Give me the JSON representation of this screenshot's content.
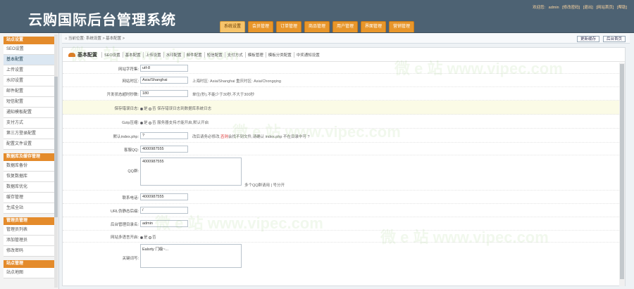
{
  "header": {
    "title": "云购国际后台管理系统",
    "tabs": [
      "系统设置",
      "会员管理",
      "订单管理",
      "商品管理",
      "用户管理",
      "界面管理",
      "营销管理"
    ],
    "active_tab": 0,
    "user_links": [
      "欢迎您:",
      "admin",
      "[修改密码]",
      "[退出]",
      "[网站首页]",
      "[帮助]"
    ]
  },
  "sidebar": {
    "groups": [
      {
        "title": "站点设置",
        "items": [
          "SEO设置",
          "基本配置",
          "上传设置",
          "水印设置",
          "邮件配置",
          "短信配置",
          "通知模板配置",
          "支付方式",
          "第三方登录配置",
          "配置文件设置"
        ]
      },
      {
        "title": "数据库及缓存管理",
        "items": [
          "数据库备份",
          "恢复数据库",
          "数据库优化",
          "缓存管理",
          "生成全站"
        ]
      },
      {
        "title": "管理员管理",
        "items": [
          "管理员列表",
          "添加管理员",
          "修改密码"
        ]
      },
      {
        "title": "站点管理",
        "items": [
          "站点地图"
        ]
      }
    ],
    "active_item": "基本配置"
  },
  "breadcrumb": {
    "text": "当前位置: 系统设置 > 基本配置 >",
    "buttons": [
      "更新缓存",
      "后台首页"
    ]
  },
  "panel": {
    "title": "基本配置",
    "subtabs": [
      "SEO设置",
      "基本配置",
      "上传设置",
      "水印配置",
      "邮件配置",
      "短信配置",
      "支付方式",
      "模板管理",
      "模板分类配置",
      "中奖通知设置"
    ]
  },
  "form": {
    "charset": {
      "label": "网站字符集:",
      "value": "utf-8"
    },
    "timezone": {
      "label": "网站时区:",
      "value": "Asia/Shanghai",
      "hint": "上海时区: Asia/Shanghai 重庆时区: Asia/Chongqing"
    },
    "timeout": {
      "label": "开发状态超时秒数:",
      "value": "180",
      "hint": "单位(秒),不能少于30秒,不大于300秒"
    },
    "error_log": {
      "label": "保存错误日志:",
      "opt_yes": "是",
      "opt_no": "否",
      "hint": "保存错误日志到数据库系统日志"
    },
    "gzip": {
      "label": "Gzip压缩:",
      "opt_yes": "是",
      "opt_no": "否",
      "hint": "服务器支持才能开启,默认开启"
    },
    "index_name": {
      "label": "默认index.php:",
      "value": "?",
      "hint_pre": "改后请务必修改,",
      "hint_red": "否则",
      "hint_post": "会找不到文件,请确认 index.php 不在目录中可 ?"
    },
    "qq": {
      "label": "客服QQ:",
      "value": "4000987555"
    },
    "qq_group": {
      "label": "QQ群:",
      "value": "4000987555",
      "hint": "多个QQ群请用 | 号分开"
    },
    "phone": {
      "label": "联系电话:",
      "value": "4000987555"
    },
    "url_suffix": {
      "label": "URL伪静态后缀:",
      "value": "/"
    },
    "admin_dir": {
      "label": "后台管理目录名:",
      "value": "admin"
    },
    "lang_pack": {
      "label": "网站多语言开启:",
      "opt_yes": "是",
      "opt_no": "否"
    },
    "keywords": {
      "label": "关键词写:",
      "value": "Ealsrty 门级~..."
    }
  },
  "watermark": "微 e 站 www.vipec.com"
}
